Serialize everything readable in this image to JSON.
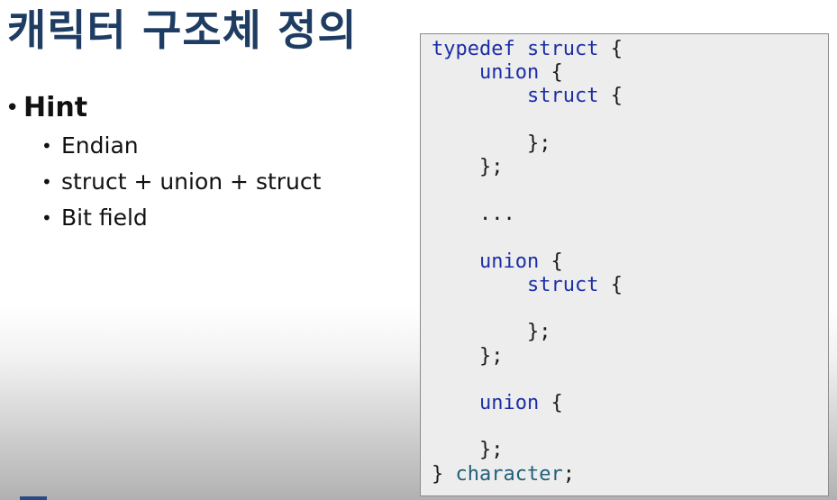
{
  "slide": {
    "title": "캐릭터 구조체 정의"
  },
  "bullets": {
    "main": "Hint",
    "subitems": [
      "Endian",
      "struct + union + struct",
      "Bit field"
    ]
  },
  "code": {
    "kw_typedef": "typedef",
    "kw_struct": "struct",
    "kw_union": "union",
    "ellipsis": "...",
    "type_name": "character",
    "open_brace": "{",
    "close_brace_semi": "};",
    "final_close": "}",
    "final_semi": ";"
  },
  "colors": {
    "title": "#1f3d63",
    "keyword": "#1c2fa8",
    "identifier": "#22607a",
    "code_background": "#ededed"
  }
}
